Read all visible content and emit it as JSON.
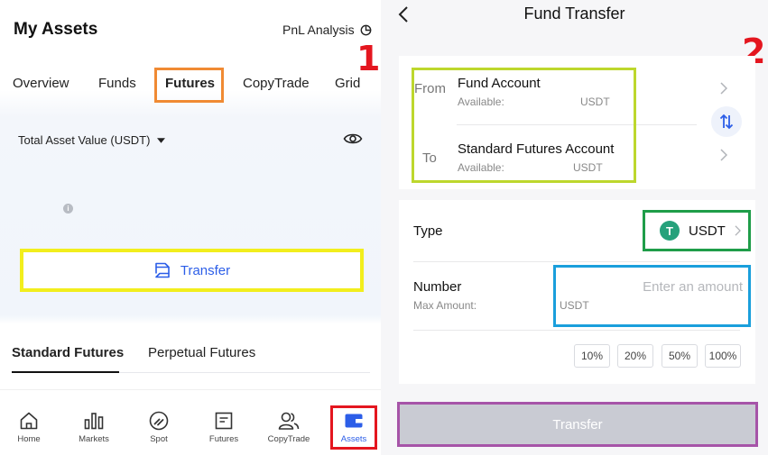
{
  "left": {
    "title": "My Assets",
    "pnl_label": "PnL Analysis",
    "step_marker": "1",
    "tabs": [
      "Overview",
      "Funds",
      "Futures",
      "CopyTrade",
      "Grid"
    ],
    "active_tab": "Futures",
    "total_asset_label": "Total Asset Value (USDT)",
    "transfer_label": "Transfer",
    "subtabs": [
      "Standard Futures",
      "Perpetual Futures"
    ],
    "active_subtab": "Standard Futures",
    "nav": [
      "Home",
      "Markets",
      "Spot",
      "Futures",
      "CopyTrade",
      "Assets"
    ],
    "active_nav": "Assets",
    "highlight_colors": {
      "orange": "#f08a33",
      "yellow": "#f2ee1d",
      "red": "#e4161f"
    }
  },
  "right": {
    "title": "Fund Transfer",
    "step_marker": "2",
    "from_label": "From",
    "from_account": "Fund Account",
    "from_available_label": "Available:",
    "from_available_unit": "USDT",
    "to_label": "To",
    "to_account": "Standard Futures Account",
    "to_available_label": "Available:",
    "to_available_unit": "USDT",
    "type_label": "Type",
    "type_value": "USDT",
    "coin_symbol": "T",
    "number_label": "Number",
    "amount_placeholder": "Enter an amount",
    "max_amount_label": "Max Amount:",
    "max_amount_unit": "USDT",
    "percent_options": [
      "10%",
      "20%",
      "50%",
      "100%"
    ],
    "transfer_label": "Transfer",
    "highlight_colors": {
      "lime": "#bdd72d",
      "green": "#1f9d49",
      "blue": "#1a9fdc",
      "purple": "#a654a8"
    },
    "accent_color": "#2c5ee8",
    "usdt_color": "#26a17b"
  }
}
